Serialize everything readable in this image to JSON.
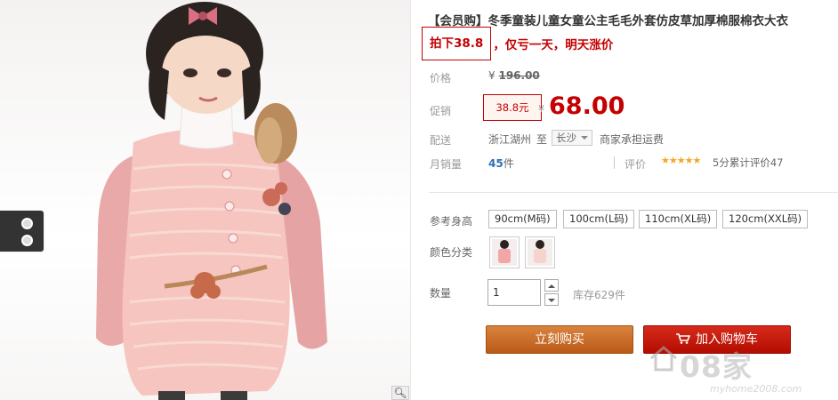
{
  "product": {
    "title": "【会员购】冬季童装儿童女童公主毛毛外套仿皮草加厚棉服棉衣大衣",
    "promo_highlight": "拍下38.8",
    "promo_tail": "，仅亏一天，明天涨价"
  },
  "price": {
    "label": "价格",
    "original": "¥ 196.00",
    "original_currency": "¥",
    "original_value": "196.00"
  },
  "promotion": {
    "label": "促销",
    "tag": "38.8元",
    "currency": "¥",
    "value": "68.00"
  },
  "delivery": {
    "label": "配送",
    "from": "浙江湖州",
    "to_word": "至",
    "city": "长沙",
    "fee_note": "商家承担运费"
  },
  "sales": {
    "label": "月销量",
    "count": "45",
    "unit": "件",
    "review_label": "评价",
    "stars": "★★★★★",
    "rating_text": "5分累计评价47"
  },
  "options": {
    "size_label": "参考身高",
    "sizes": [
      "90cm(M码)",
      "100cm(L码)",
      "110cm(XL码)",
      "120cm(XXL码)"
    ],
    "color_label": "颜色分类"
  },
  "quantity": {
    "label": "数量",
    "value": "1",
    "stock": "库存629件"
  },
  "actions": {
    "buy_now": "立刻购买",
    "add_to_cart": "加入购物车"
  },
  "watermark": {
    "brand": "08家",
    "url": "myhome2008.com"
  },
  "icons": {
    "zoom": "magnifier-icon",
    "cart": "cart-icon",
    "side": "side-tab-icon"
  },
  "colors": {
    "accent_red": "#c40000",
    "buy_orange": "#c96a26",
    "cart_red": "#c41b0c",
    "link_blue": "#2a6fb0",
    "star": "#f5a623"
  }
}
